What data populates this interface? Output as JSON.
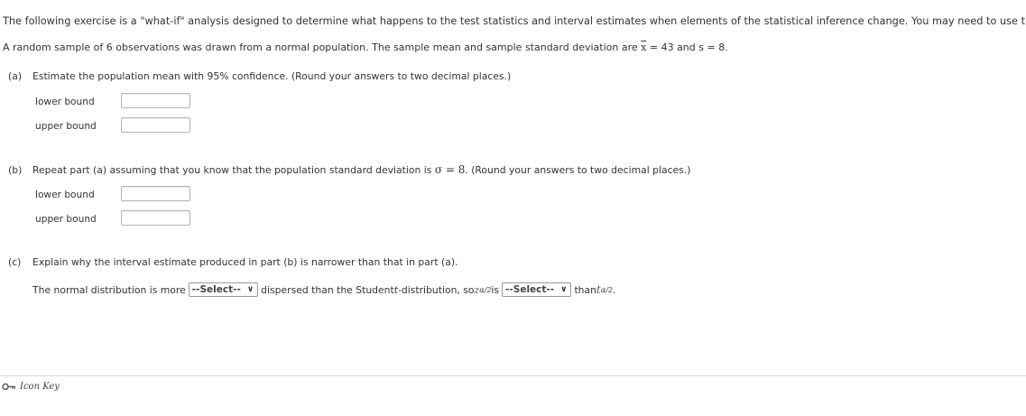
{
  "intro": "The following exercise is a \"what-if\" analysis designed to determine what happens to the test statistics and interval estimates when elements of the statistical inference change. You may need to use the",
  "setup": {
    "text_before": "A random sample of 6 observations was drawn from a normal population. The sample mean and sample standard deviation are ",
    "xbar_symbol": "x",
    "xbar_value": " = 43 and s = 8."
  },
  "part_a": {
    "letter": "(a)",
    "text": "Estimate the population mean with 95% confidence. (Round your answers to two decimal places.)",
    "lower_label": "lower bound",
    "upper_label": "upper bound",
    "lower_value": "",
    "upper_value": ""
  },
  "part_b": {
    "letter": "(b)",
    "text_before": "Repeat part (a) assuming that you know that the population standard deviation is ",
    "sigma": "σ = 8",
    "text_after": ". (Round your answers to two decimal places.)",
    "lower_label": "lower bound",
    "upper_label": "upper bound",
    "lower_value": "",
    "upper_value": ""
  },
  "part_c": {
    "letter": "(c)",
    "text": "Explain why the interval estimate produced in part (b) is narrower than that in part (a).",
    "s1": "The normal distribution is more",
    "select1": "--Select--",
    "s2": "dispersed than the Student ",
    "t": "t",
    "s3": "-distribution, so ",
    "z": "z",
    "z_sub": "α/2",
    "s4": " is",
    "select2": "--Select--",
    "s5": "than ",
    "tsym": "t",
    "t_sub": "α/2",
    "s6": "."
  },
  "footer": {
    "icon_key_label": "Icon Key"
  },
  "colors": {
    "text": "#333333",
    "input_border": "#b5b5b5",
    "divider": "#d9d9d9"
  }
}
